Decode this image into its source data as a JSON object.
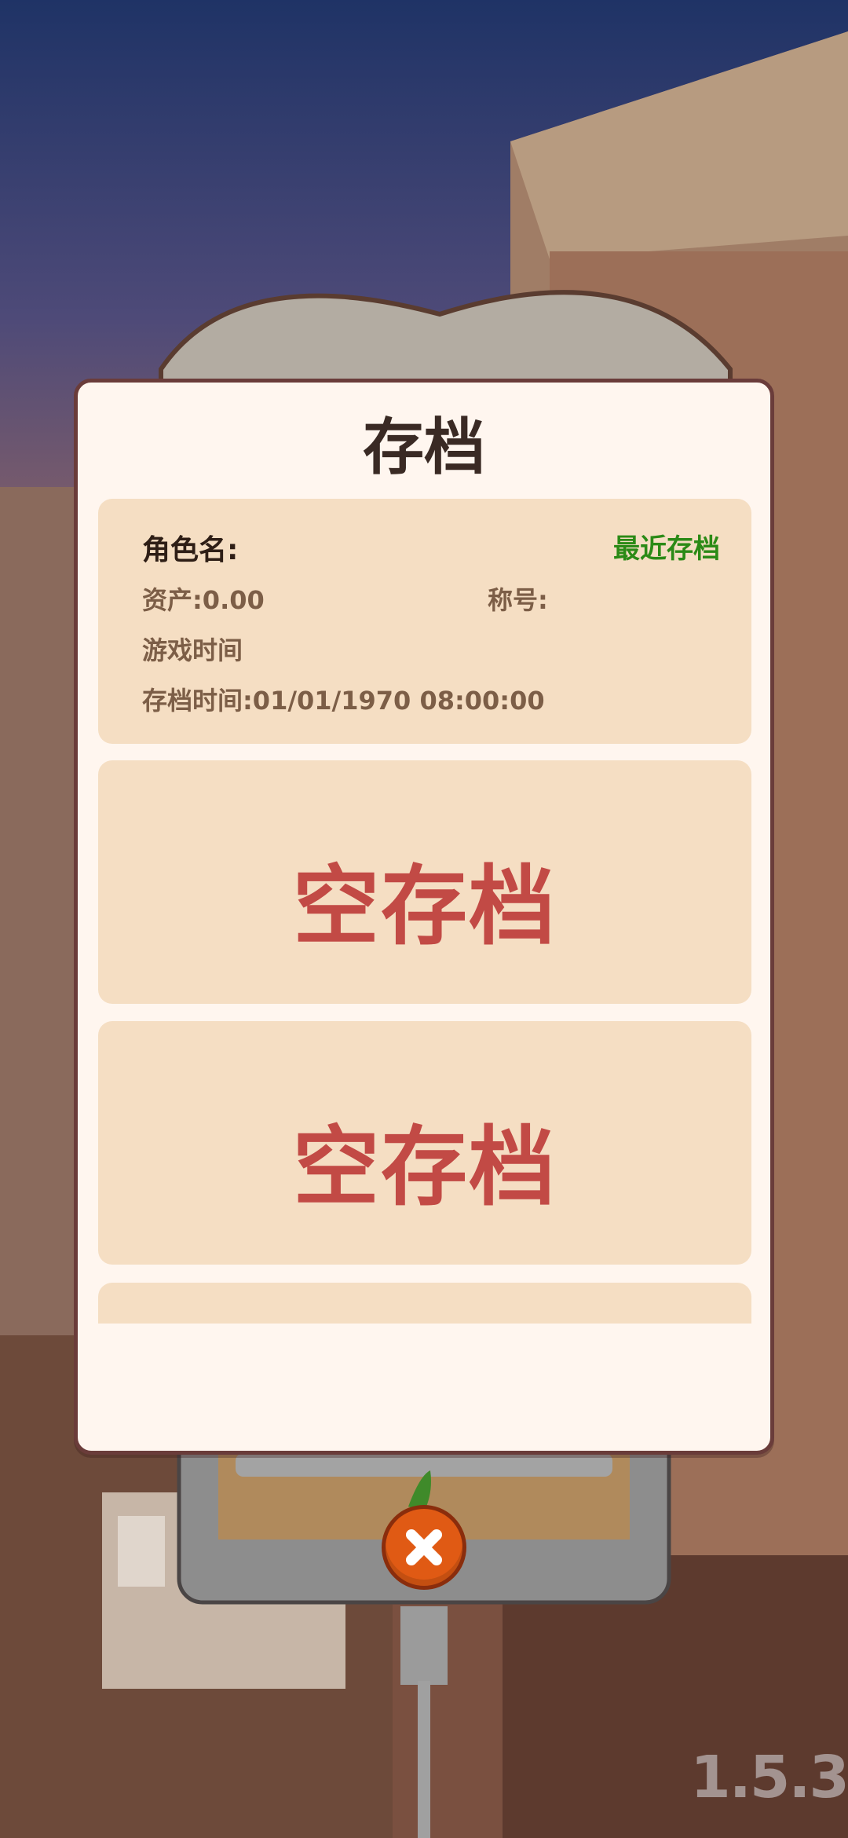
{
  "dialog": {
    "title": "存档",
    "slots": [
      {
        "character_label": "角色名:",
        "recent_label": "最近存档",
        "assets_text": "资产:0.00",
        "rank_text": "称号:",
        "playtime_text": "游戏时间",
        "savetime_text": "存档时间:01/01/1970  08:00:00"
      },
      {
        "empty_label": "空存档"
      },
      {
        "empty_label": "空存档"
      }
    ]
  },
  "close_icon": "close-x-icon",
  "version": "1.5.3",
  "colors": {
    "dialog_bg": "#fff6ef",
    "slot_bg": "#f5dec3",
    "empty_text": "#c24a45",
    "recent_text": "#2b8a16",
    "close_button": "#e05a14"
  }
}
